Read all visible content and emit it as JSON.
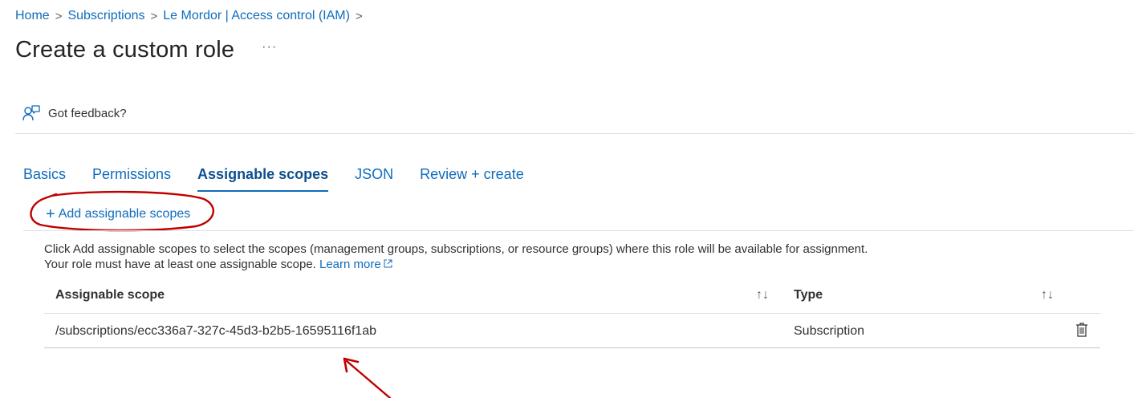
{
  "breadcrumb": {
    "items": [
      "Home",
      "Subscriptions",
      "Le Mordor | Access control (IAM)"
    ],
    "separator": ">"
  },
  "page": {
    "title": "Create a custom role",
    "more_label": "···"
  },
  "toolbar": {
    "feedback_label": "Got feedback?",
    "feedback_icon": "feedback-icon"
  },
  "tabs": [
    {
      "label": "Basics",
      "active": false
    },
    {
      "label": "Permissions",
      "active": false
    },
    {
      "label": "Assignable scopes",
      "active": true
    },
    {
      "label": "JSON",
      "active": false
    },
    {
      "label": "Review + create",
      "active": false
    }
  ],
  "actions": {
    "add_label": "Add assignable scopes",
    "add_icon": "plus-icon"
  },
  "info": {
    "line1": "Click Add assignable scopes to select the scopes (management groups, subscriptions, or resource groups) where this role will be available for assignment.",
    "line2": "Your role must have at least one assignable scope.",
    "learn_more": "Learn more"
  },
  "table": {
    "columns": [
      "Assignable scope",
      "Type"
    ],
    "sort_icon": "↑↓",
    "rows": [
      {
        "scope": "/subscriptions/ecc336a7-327c-45d3-b2b5-16595116f1ab",
        "type": "Subscription"
      }
    ]
  },
  "colors": {
    "link": "#0f6cbd",
    "annotation": "#c00000",
    "text": "#323130"
  }
}
